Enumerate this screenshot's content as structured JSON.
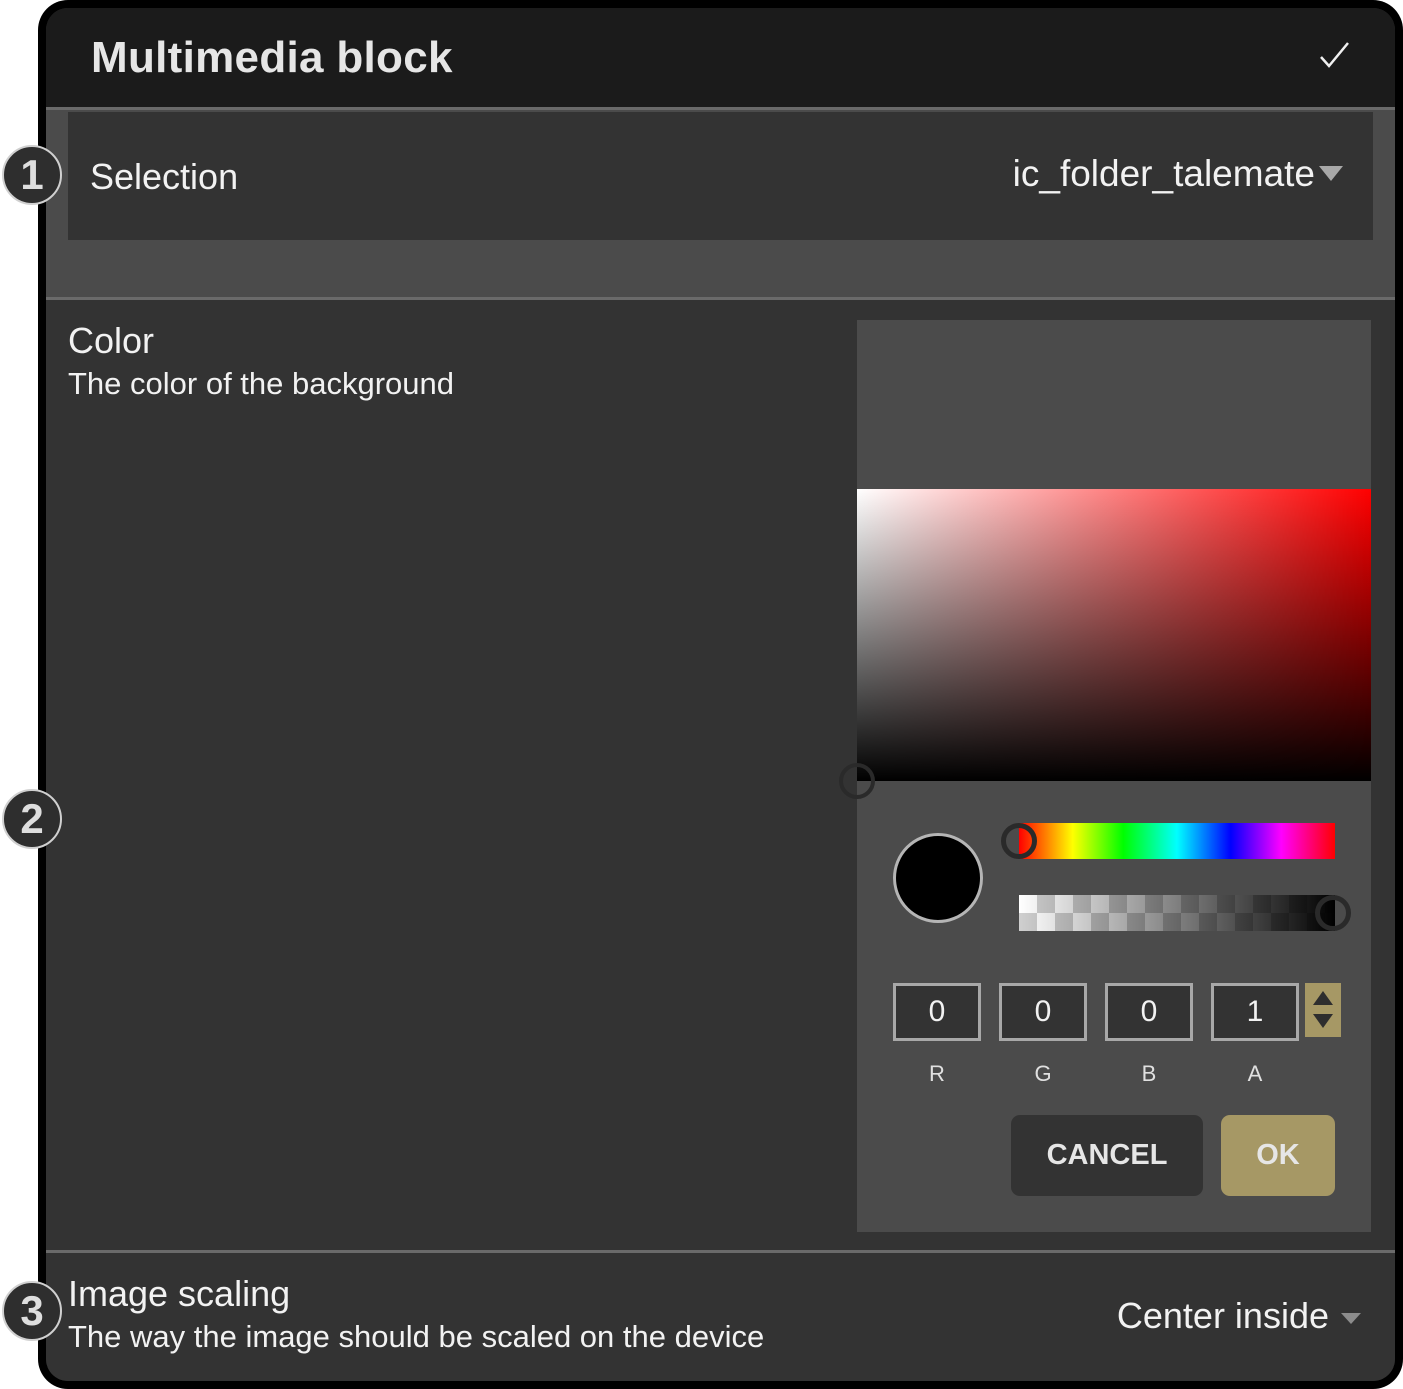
{
  "header": {
    "title": "Multimedia block",
    "confirm_icon": "check-icon"
  },
  "selection": {
    "label": "Selection",
    "value": "ic_folder_talemate",
    "dropdown_icon": "caret-down-icon"
  },
  "color": {
    "label": "Color",
    "description": "The color of the background",
    "picker": {
      "current_color": "#000000",
      "hue": 0,
      "saturation": 0,
      "brightness": 0,
      "alpha": 1,
      "inputs": [
        {
          "label": "R",
          "value": "0"
        },
        {
          "label": "G",
          "value": "0"
        },
        {
          "label": "B",
          "value": "0"
        },
        {
          "label": "A",
          "value": "1"
        }
      ],
      "cancel_label": "CANCEL",
      "ok_label": "OK",
      "accent_color": "#a69865"
    }
  },
  "image_scaling": {
    "label": "Image scaling",
    "description": "The way the image should be scaled on the device",
    "value": "Center inside"
  },
  "annotations": [
    "1",
    "2",
    "3"
  ]
}
